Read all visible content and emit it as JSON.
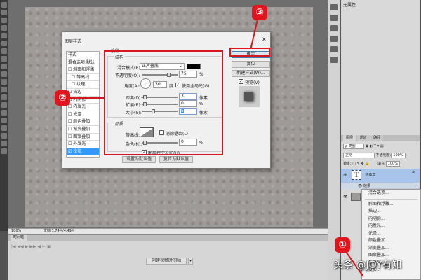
{
  "status": {
    "zoom": "100%",
    "doc": "文档:1.74M/4.49M"
  },
  "timeline": {
    "tab": "时间轴",
    "create_button": "创建视频时间轴"
  },
  "properties": {
    "title": "无属性"
  },
  "layers": {
    "tabs": [
      "图层",
      "通道",
      "路径"
    ],
    "filter": "ρ 类型",
    "blend": "正常",
    "opacity_label": "不透明度:",
    "opacity": "100%",
    "lock_label": "锁定:",
    "fill_label": "填充:",
    "fill": "100%",
    "layer1": {
      "icon": "T",
      "name": "转换字",
      "fx": "fx"
    },
    "effects_label": "效果"
  },
  "context_menu": [
    "混合选项...",
    "斜面和浮雕...",
    "描边...",
    "内阴影...",
    "内发光...",
    "光泽...",
    "颜色叠加...",
    "渐变叠加...",
    "图案叠加...",
    "外发光...",
    "投影..."
  ],
  "dialog": {
    "title": "图层样式",
    "close": "✕",
    "styles": [
      "样式",
      "混合选项:默认",
      "斜面和浮雕",
      "等高线",
      "纹理",
      "描边",
      "内阴影",
      "内发光",
      "光泽",
      "颜色叠加",
      "渐变叠加",
      "图案叠加",
      "外发光",
      "投影"
    ],
    "section": "投影",
    "structure": "结构",
    "quality": "品质",
    "blend_label": "混合模式(B):",
    "blend_value": "正片叠底",
    "shadow_color": "#000000",
    "opacity_label": "不透明度(O):",
    "opacity": "75",
    "angle_label": "角度(A):",
    "angle": "30",
    "angle_unit": "度",
    "global_light": "使用全局光(G)",
    "distance_label": "距离(D):",
    "distance": "3",
    "spread_label": "扩展(R):",
    "spread": "0",
    "size_label": "大小(S):",
    "size": "5",
    "px": "像素",
    "pct": "%",
    "contour_label": "等高线:",
    "antialias": "消除锯齿(L)",
    "noise_label": "杂色(N):",
    "noise": "0",
    "knockout": "图层挖空投影(U)",
    "set_default": "设置为默认值",
    "reset_default": "复位为默认值",
    "ok": "确定",
    "reset": "复位",
    "new_style": "新建样式(W)...",
    "preview": "预览(V)"
  },
  "annotations": {
    "one": "①",
    "two": "②",
    "three": "③",
    "accent": "#d7161d"
  },
  "watermark": "头条 @JOY有知"
}
